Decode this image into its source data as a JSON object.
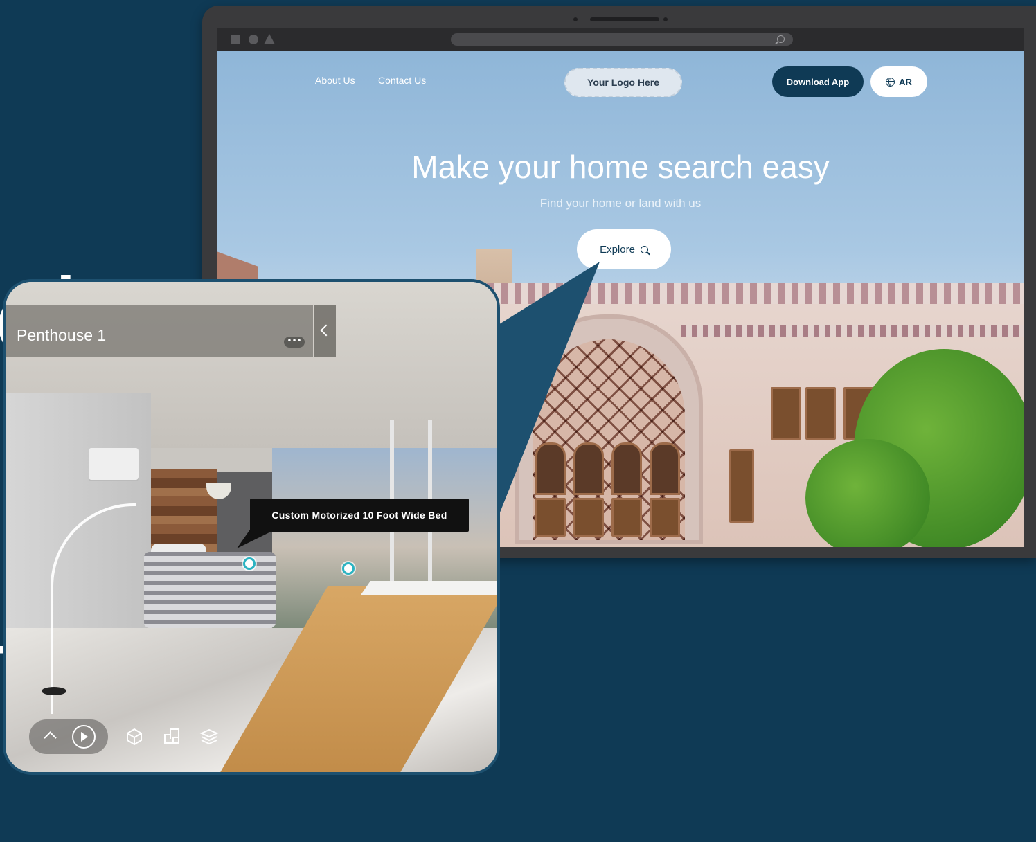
{
  "background_heading": {
    "line1": "ch",
    "line2": "th"
  },
  "site": {
    "nav": {
      "about": "About Us",
      "contact": "Contact Us"
    },
    "logo": "Your Logo Here",
    "download_button": "Download App",
    "language_button": "AR",
    "hero": {
      "title": "Make your home search easy",
      "subtitle": "Find your home or land with us",
      "cta": "Explore"
    }
  },
  "tour": {
    "title": "Penthouse 1",
    "more_label": "•••",
    "tooltip": "Custom Motorized 10 Foot Wide Bed"
  },
  "colors": {
    "page_background": "#0f3a55",
    "accent_dark": "#0f3a55",
    "hotspot": "#2bb3c2"
  },
  "icons": [
    "globe-icon",
    "search-icon",
    "chevron-left-icon",
    "chevron-up-icon",
    "play-icon",
    "dollhouse-icon",
    "floorplan-icon",
    "floors-icon",
    "more-icon"
  ]
}
